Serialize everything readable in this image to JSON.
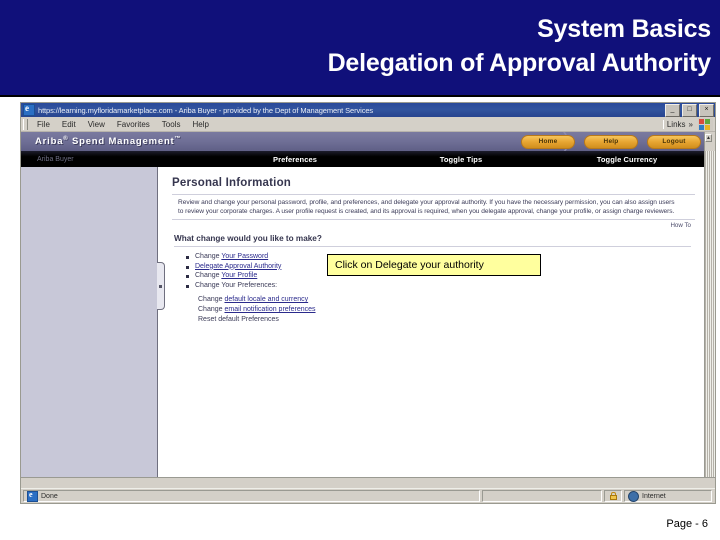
{
  "slide": {
    "title_line1": "System Basics",
    "title_line2": "Delegation of Approval Authority",
    "banner_color": "#10107a",
    "footer": "Page - 6"
  },
  "browser": {
    "titlebar": {
      "icon": "ie-document-icon",
      "text": "https://learning.myfloridamarketplace.com - Ariba Buyer - provided by the Dept of Management Services",
      "minimize": "_",
      "restore": "□",
      "close": "×"
    },
    "menu": {
      "items": [
        {
          "label": "File"
        },
        {
          "label": "Edit"
        },
        {
          "label": "View"
        },
        {
          "label": "Favorites"
        },
        {
          "label": "Tools"
        },
        {
          "label": "Help"
        }
      ],
      "links_label": "Links",
      "links_chevron": "»"
    },
    "statusbar": {
      "status_text": "Done",
      "zone_text": "Internet",
      "lock_icon": "secure-lock-icon",
      "globe_icon": "internet-zone-icon"
    }
  },
  "app": {
    "brand": "Ariba",
    "brand_sup": "®",
    "brand_rest": "Spend Management",
    "brand_tm": "™",
    "buttons": [
      {
        "label": "Home",
        "name": "home-button"
      },
      {
        "label": "Help",
        "name": "help-button"
      },
      {
        "label": "Logout",
        "name": "logout-button"
      }
    ],
    "nav": {
      "left_label": "Ariba Buyer",
      "items": [
        {
          "label": "Preferences"
        },
        {
          "label": "Toggle Tips"
        },
        {
          "label": "Toggle Currency"
        }
      ]
    }
  },
  "page": {
    "heading": "Personal Information",
    "intro": "Review and change your personal password, profile, and preferences, and delegate your approval authority. If you have the necessary permission, you can also assign users to review your corporate charges. A user profile request is created, and its approval is required, when you delegate approval, change your profile, or assign charge reviewers.",
    "howto": "How To",
    "question": "What change would you like to make?",
    "options": [
      {
        "prefix": "Change ",
        "link": "Your Password"
      },
      {
        "prefix": "",
        "link": "Delegate Approval Authority"
      },
      {
        "prefix": "Change ",
        "link": "Your Profile"
      },
      {
        "prefix": "Change Your Preferences:",
        "link": ""
      }
    ],
    "suboptions": [
      {
        "prefix": "Change ",
        "link": "default locale and currency"
      },
      {
        "prefix": "Change ",
        "link": "email notification preferences"
      },
      {
        "prefix": "Reset default Preferences",
        "link": ""
      }
    ]
  },
  "callout": {
    "text": "Click on Delegate your authority",
    "bg": "#ffff9e",
    "border": "#000000"
  }
}
